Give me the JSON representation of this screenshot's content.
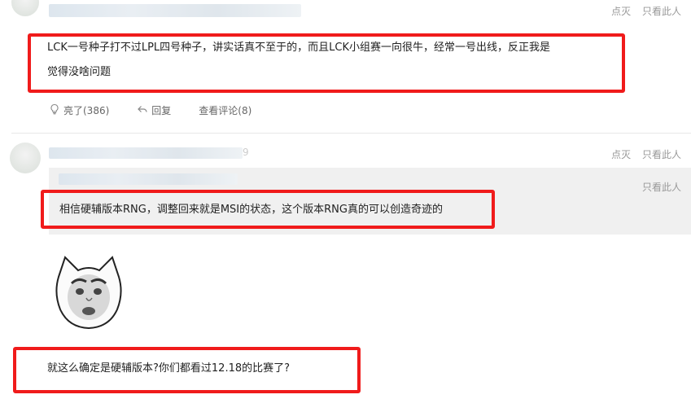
{
  "post1": {
    "actions": [
      "点灭",
      "只看此人"
    ],
    "text_line1": "LCK一号种子打不过LPL四号种子，讲实话真不至于的，而且LCK小组赛一向很牛，经常一号出线，反正我是",
    "text_line2": "觉得没啥问题",
    "footer": {
      "like_label": "亮了(386)",
      "reply_label": "回复",
      "view_comments_label": "查看评论(8)"
    }
  },
  "post2": {
    "actions": [
      "点灭",
      "只看此人"
    ],
    "username_partial": "9",
    "quote": {
      "action": "只看此人",
      "text": "相信硬辅版本RNG，调整回来就是MSI的状态，这个版本RNG真的可以创造奇迹的"
    },
    "text": "就这么确定是硬辅版本?你们都看过12.18的比赛了?"
  },
  "colors": {
    "highlight_box": "#f01b1b",
    "quote_bg": "#f0f0f0"
  },
  "icons": [
    "lightbulb-icon",
    "reply-arrow-icon"
  ]
}
